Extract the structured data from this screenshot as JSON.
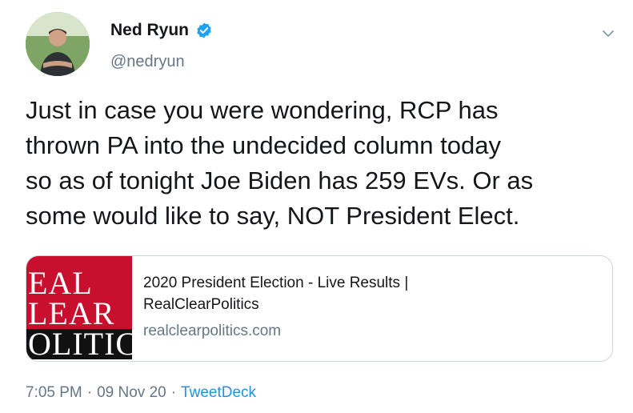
{
  "author": {
    "name": "Ned Ryun",
    "handle": "@nedryun",
    "verified": true,
    "avatar_icon": "profile-photo"
  },
  "tweet": {
    "text": "Just in case you were wondering, RCP has\nthrown PA into the undecided column today\nso as of tonight Joe Biden has 259 EVs. Or as\nsome would like to say, NOT President Elect."
  },
  "link_card": {
    "thumbnail_lines": [
      "EAL",
      "LEAR",
      "OLITIC"
    ],
    "title": "2020 President Election - Live Results |\nRealClearPolitics",
    "domain": "realclearpolitics.com"
  },
  "meta": {
    "time": "7:05 PM",
    "separator": "·",
    "date": "09 Nov 20",
    "source": "TweetDeck"
  },
  "colors": {
    "verified_blue": "#1da1f2",
    "link_blue": "#1b95e0",
    "rcp_red": "#c8102e",
    "muted_gray": "#657786"
  },
  "icons": {
    "menu": "chevron-down-icon",
    "verified": "verified-badge-icon"
  }
}
